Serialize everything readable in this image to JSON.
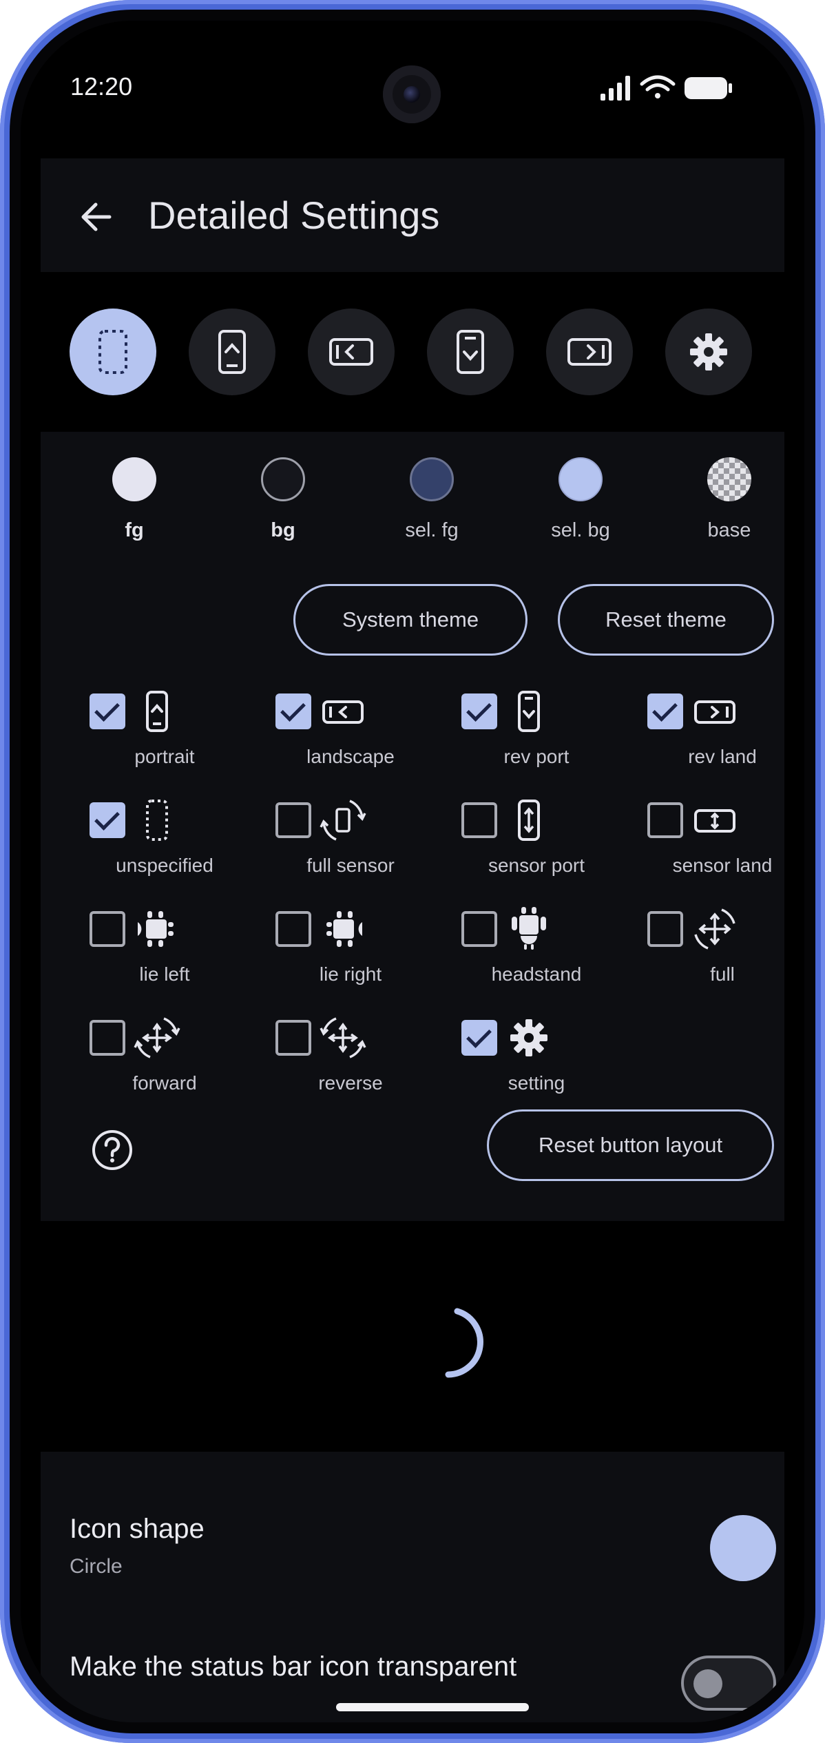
{
  "status_bar": {
    "time": "12:20"
  },
  "appbar": {
    "title": "Detailed Settings"
  },
  "mode_buttons": [
    {
      "name": "unspecified",
      "icon": "dotted-phone-icon",
      "active": true
    },
    {
      "name": "portrait",
      "icon": "phone-portrait-icon",
      "active": false
    },
    {
      "name": "landscape",
      "icon": "phone-landscape-icon",
      "active": false
    },
    {
      "name": "rev-port",
      "icon": "phone-reverse-portrait-icon",
      "active": false
    },
    {
      "name": "rev-land",
      "icon": "phone-reverse-landscape-icon",
      "active": false
    },
    {
      "name": "setting",
      "icon": "gear-icon",
      "active": false
    }
  ],
  "swatches": [
    {
      "label": "fg",
      "color": "#e4e4f0"
    },
    {
      "label": "bg",
      "color": "#15161c"
    },
    {
      "label": "sel. fg",
      "color": "#34416a"
    },
    {
      "label": "sel. bg",
      "color": "#b5c4f0"
    },
    {
      "label": "base",
      "color": "checker"
    }
  ],
  "buttons": {
    "system_theme": "System theme",
    "reset_theme": "Reset theme",
    "reset_layout": "Reset button layout"
  },
  "options": [
    {
      "label": "portrait",
      "checked": true,
      "icon": "phone-portrait-icon"
    },
    {
      "label": "landscape",
      "checked": true,
      "icon": "phone-landscape-icon"
    },
    {
      "label": "rev port",
      "checked": true,
      "icon": "phone-reverse-portrait-icon"
    },
    {
      "label": "rev land",
      "checked": true,
      "icon": "phone-reverse-landscape-icon"
    },
    {
      "label": "unspecified",
      "checked": true,
      "icon": "dotted-phone-icon"
    },
    {
      "label": "full sensor",
      "checked": false,
      "icon": "rotate-phone-icon"
    },
    {
      "label": "sensor port",
      "checked": false,
      "icon": "sensor-portrait-icon"
    },
    {
      "label": "sensor land",
      "checked": false,
      "icon": "sensor-landscape-icon"
    },
    {
      "label": "lie left",
      "checked": false,
      "icon": "robot-left-icon"
    },
    {
      "label": "lie right",
      "checked": false,
      "icon": "robot-right-icon"
    },
    {
      "label": "headstand",
      "checked": false,
      "icon": "robot-upside-icon"
    },
    {
      "label": "full",
      "checked": false,
      "icon": "rotate-arrows-icon"
    },
    {
      "label": "forward",
      "checked": false,
      "icon": "rotate-forward-icon"
    },
    {
      "label": "reverse",
      "checked": false,
      "icon": "rotate-reverse-icon"
    },
    {
      "label": "setting",
      "checked": true,
      "icon": "gear-icon"
    }
  ],
  "icon_shape": {
    "title": "Icon shape",
    "value": "Circle"
  },
  "transparent": {
    "label": "Make the status bar icon transparent",
    "enabled": false
  },
  "colors": {
    "accent": "#b5c4f0",
    "surface": "#0d0e12",
    "frame": "#4a68d6"
  }
}
